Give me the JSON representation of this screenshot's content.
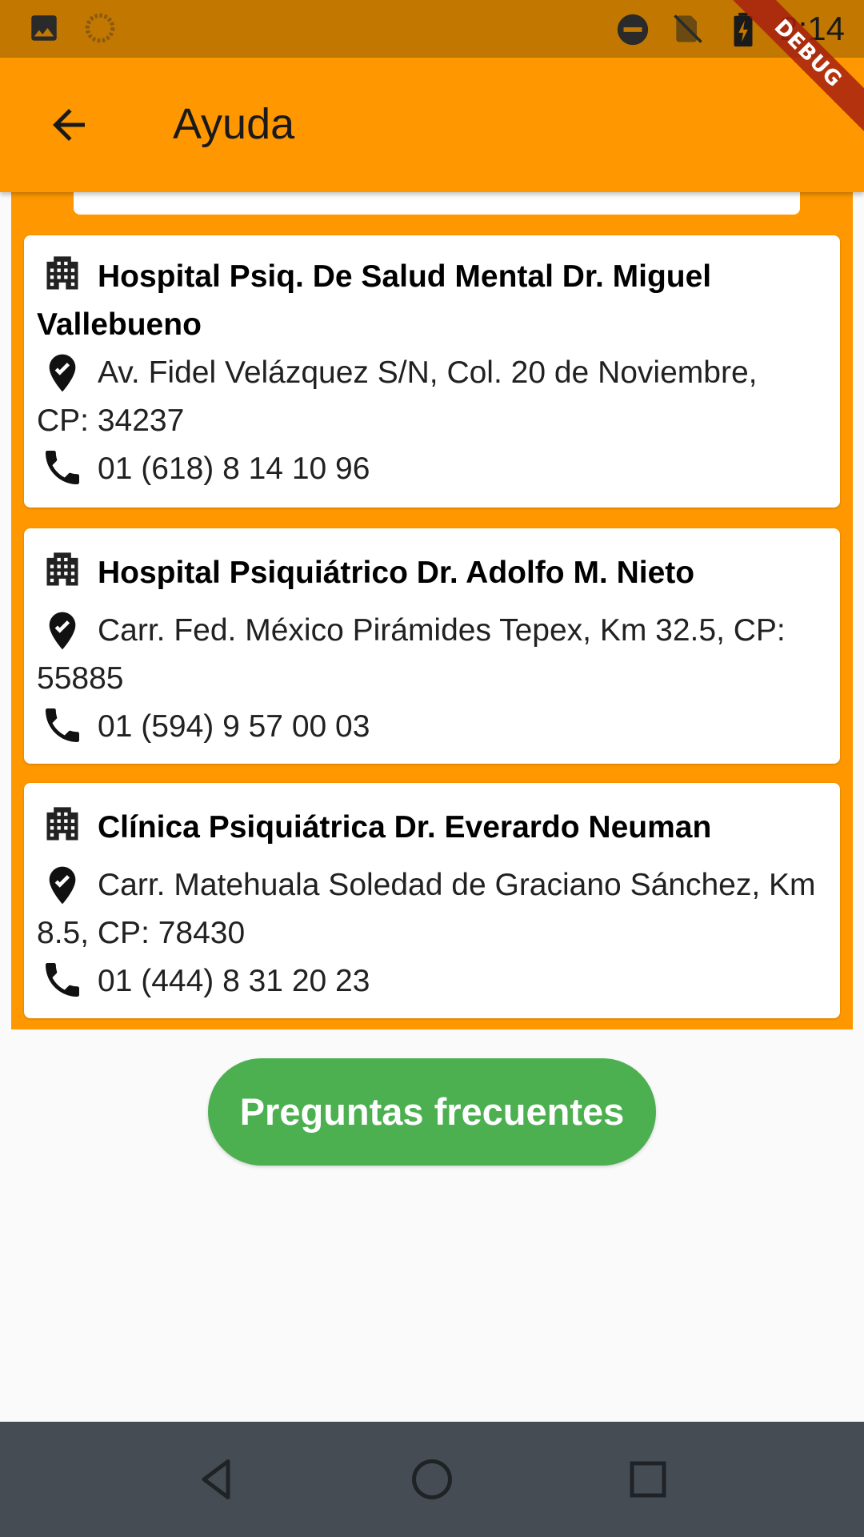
{
  "status_bar": {
    "time": "2:14",
    "left_icons": [
      "image-icon",
      "sync-icon"
    ],
    "right_icons": [
      "do-not-disturb-icon",
      "no-sim-icon",
      "battery-charging-icon"
    ]
  },
  "app_bar": {
    "title": "Ayuda",
    "back_icon": "arrow-back-icon"
  },
  "debug_banner": "DEBUG",
  "hospitals": [
    {
      "name": "Hospital Psiq. De Salud Mental Dr. Miguel Vallebueno",
      "address": "Av. Fidel Velázquez S/N, Col. 20 de Noviembre, CP: 34237",
      "phone": "01 (618) 8 14 10 96"
    },
    {
      "name": "Hospital Psiquiátrico Dr. Adolfo M. Nieto",
      "address": "Carr. Fed. México Pirámides Tepex, Km 32.5, CP: 55885",
      "phone": "01 (594) 9 57 00 03"
    },
    {
      "name": "Clínica Psiquiátrica Dr. Everardo Neuman",
      "address": "Carr. Matehuala Soledad de Graciano Sánchez, Km 8.5, CP: 78430",
      "phone": "01 (444) 8 31 20 23"
    }
  ],
  "faq_button": {
    "label": "Preguntas frecuentes"
  },
  "colors": {
    "app_bar": "#FF9800",
    "status_bar": "#C27800",
    "faq_button": "#4CAF50",
    "nav_bar": "#464C53"
  }
}
